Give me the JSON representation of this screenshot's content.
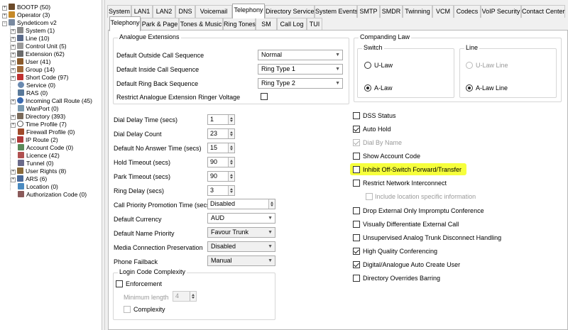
{
  "tree": [
    {
      "label": "BOOTP (50)",
      "icon": "bootp-icon"
    },
    {
      "label": "Operator (3)",
      "icon": "operator-icon"
    },
    {
      "label": "Syndeticom v2",
      "icon": "system-root-icon"
    },
    {
      "label": "System (1)",
      "icon": "system-icon"
    },
    {
      "label": "Line (10)",
      "icon": "line-icon"
    },
    {
      "label": "Control Unit (5)",
      "icon": "control-unit-icon"
    },
    {
      "label": "Extension (62)",
      "icon": "extension-icon"
    },
    {
      "label": "User (41)",
      "icon": "user-icon"
    },
    {
      "label": "Group (14)",
      "icon": "group-icon"
    },
    {
      "label": "Short Code (97)",
      "icon": "short-code-icon"
    },
    {
      "label": "Service (0)",
      "icon": "service-icon"
    },
    {
      "label": "RAS (0)",
      "icon": "ras-icon"
    },
    {
      "label": "Incoming Call Route (45)",
      "icon": "incoming-call-route-icon"
    },
    {
      "label": "WanPort (0)",
      "icon": "wanport-icon"
    },
    {
      "label": "Directory (393)",
      "icon": "directory-icon"
    },
    {
      "label": "Time Profile (7)",
      "icon": "time-profile-icon"
    },
    {
      "label": "Firewall Profile (0)",
      "icon": "firewall-icon"
    },
    {
      "label": "IP Route (2)",
      "icon": "ip-route-icon"
    },
    {
      "label": "Account Code (0)",
      "icon": "account-code-icon"
    },
    {
      "label": "Licence (42)",
      "icon": "licence-icon"
    },
    {
      "label": "Tunnel (0)",
      "icon": "tunnel-icon"
    },
    {
      "label": "User Rights (8)",
      "icon": "user-rights-icon"
    },
    {
      "label": "ARS (6)",
      "icon": "ars-icon"
    },
    {
      "label": "Location (0)",
      "icon": "location-icon"
    },
    {
      "label": "Authorization Code (0)",
      "icon": "authorization-code-icon"
    }
  ],
  "top_tabs": [
    "System",
    "LAN1",
    "LAN2",
    "DNS",
    "Voicemail",
    "Telephony",
    "Directory Services",
    "System Events",
    "SMTP",
    "SMDR",
    "Twinning",
    "VCM",
    "Codecs",
    "VoIP Security",
    "Contact Center"
  ],
  "sub_tabs": [
    "Telephony",
    "Park & Page",
    "Tones & Music",
    "Ring Tones",
    "SM",
    "Call Log",
    "TUI"
  ],
  "analogue": {
    "title": "Analogue Extensions",
    "outside_label": "Default Outside Call Sequence",
    "outside_value": "Normal",
    "inside_label": "Default Inside Call Sequence",
    "inside_value": "Ring Type 1",
    "ringback_label": "Default Ring Back Sequence",
    "ringback_value": "Ring Type 2",
    "restrict_label": "Restrict Analogue Extension Ringer Voltage"
  },
  "settings": {
    "dial_delay_time_label": "Dial Delay Time (secs)",
    "dial_delay_time": "1",
    "dial_delay_count_label": "Dial Delay Count",
    "dial_delay_count": "23",
    "no_answer_label": "Default No Answer Time (secs)",
    "no_answer": "15",
    "hold_timeout_label": "Hold Timeout (secs)",
    "hold_timeout": "90",
    "park_timeout_label": "Park Timeout (secs)",
    "park_timeout": "90",
    "ring_delay_label": "Ring Delay (secs)",
    "ring_delay": "3",
    "promotion_label": "Call Priority Promotion Time (secs)",
    "promotion": "Disabled",
    "currency_label": "Default Currency",
    "currency": "AUD",
    "name_priority_label": "Default Name Priority",
    "name_priority": "Favour Trunk",
    "media_label": "Media Connection Preservation",
    "media": "Disabled",
    "fallback_label": "Phone Failback",
    "fallback": "Manual"
  },
  "login": {
    "title": "Login Code Complexity",
    "enforcement": "Enforcement",
    "min_length_label": "Minimum length",
    "min_length": "4",
    "complexity": "Complexity"
  },
  "companding": {
    "title": "Companding Law",
    "switch_title": "Switch",
    "switch_ulaw": "U-Law",
    "switch_alaw": "A-Law",
    "line_title": "Line",
    "line_ulaw": "U-Law Line",
    "line_alaw": "A-Law Line"
  },
  "options": {
    "dss_status": "DSS Status",
    "auto_hold": "Auto Hold",
    "dial_by_name": "Dial By Name",
    "show_account_code": "Show Account Code",
    "inhibit": "Inhibit Off-Switch Forward/Transfer",
    "restrict_network": "Restrict Network Interconnect",
    "include_location": "Include location specific information",
    "drop_external": "Drop External Only Impromptu Conference",
    "visually_diff": "Visually Differentiate External Call",
    "unsupervised": "Unsupervised Analog Trunk Disconnect Handling",
    "hq_conf": "High Quality Conferencing",
    "digital_analogue": "Digital/Analogue Auto Create User",
    "dir_overrides": "Directory Overrides Barring"
  },
  "colors": {
    "highlight": "#f6ff3c"
  }
}
